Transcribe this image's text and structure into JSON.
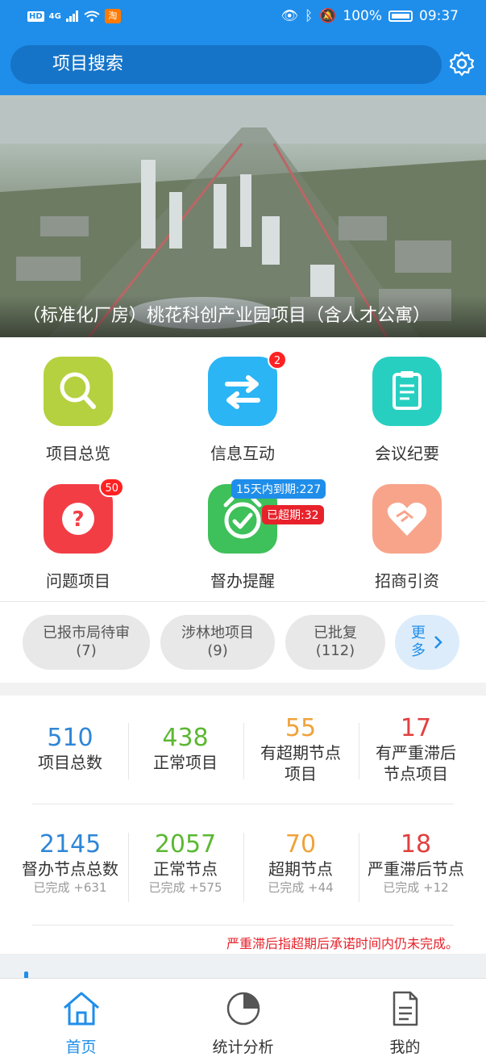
{
  "status_bar": {
    "battery": "100%",
    "time": "09:37",
    "network": "4G",
    "hd": "HD"
  },
  "header": {
    "search_label": "项目搜索"
  },
  "banner": {
    "caption": "（标准化厂房）桃花科创产业园项目（含人才公寓）"
  },
  "grid": [
    {
      "label": "项目总览",
      "icon": "search-icon",
      "color": "#b5d13f"
    },
    {
      "label": "信息互动",
      "icon": "swap-arrows-icon",
      "color": "#2bb5f5",
      "badge": "2"
    },
    {
      "label": "会议纪要",
      "icon": "clipboard-icon",
      "color": "#27cfc1"
    },
    {
      "label": "问题项目",
      "icon": "question-icon",
      "color": "#f23d45",
      "badge": "50"
    },
    {
      "label": "督办提醒",
      "icon": "alarm-clock-icon",
      "color": "#3ec05a",
      "tag_due": "15天内到期:227",
      "tag_overdue": "已超期:32"
    },
    {
      "label": "招商引资",
      "icon": "handshake-heart-icon",
      "color": "#f8a48a"
    }
  ],
  "chips": [
    {
      "label": "已报市局待审",
      "count": "(7)"
    },
    {
      "label": "涉林地项目",
      "count": "(9)"
    },
    {
      "label": "已批复",
      "count": "(112)"
    },
    {
      "label1": "更",
      "label2": "多"
    }
  ],
  "stats_row1": [
    {
      "value": "510",
      "label": "项目总数",
      "color": "#2f86d6"
    },
    {
      "value": "438",
      "label": "正常项目",
      "color": "#5bb832"
    },
    {
      "value": "55",
      "label1": "有超期节点",
      "label2": "项目",
      "color": "#f0a23a"
    },
    {
      "value": "17",
      "label1": "有严重滞后",
      "label2": "节点项目",
      "color": "#e0403f"
    }
  ],
  "stats_row2": [
    {
      "value": "2145",
      "label": "督办节点总数",
      "sub": "已完成 +631",
      "color": "#2f86d6"
    },
    {
      "value": "2057",
      "label": "正常节点",
      "sub": "已完成 +575",
      "color": "#5bb832"
    },
    {
      "value": "70",
      "label": "超期节点",
      "sub": "已完成 +44",
      "color": "#f0a23a"
    },
    {
      "value": "18",
      "label": "严重滞后节点",
      "sub": "已完成 +12",
      "color": "#e0403f"
    }
  ],
  "note": "严重滞后指超期后承诺时间内仍未完成。",
  "tabs": [
    {
      "label": "首页",
      "icon": "home-icon",
      "active": true
    },
    {
      "label": "统计分析",
      "icon": "pie-chart-icon"
    },
    {
      "label": "我的",
      "icon": "document-icon"
    }
  ]
}
